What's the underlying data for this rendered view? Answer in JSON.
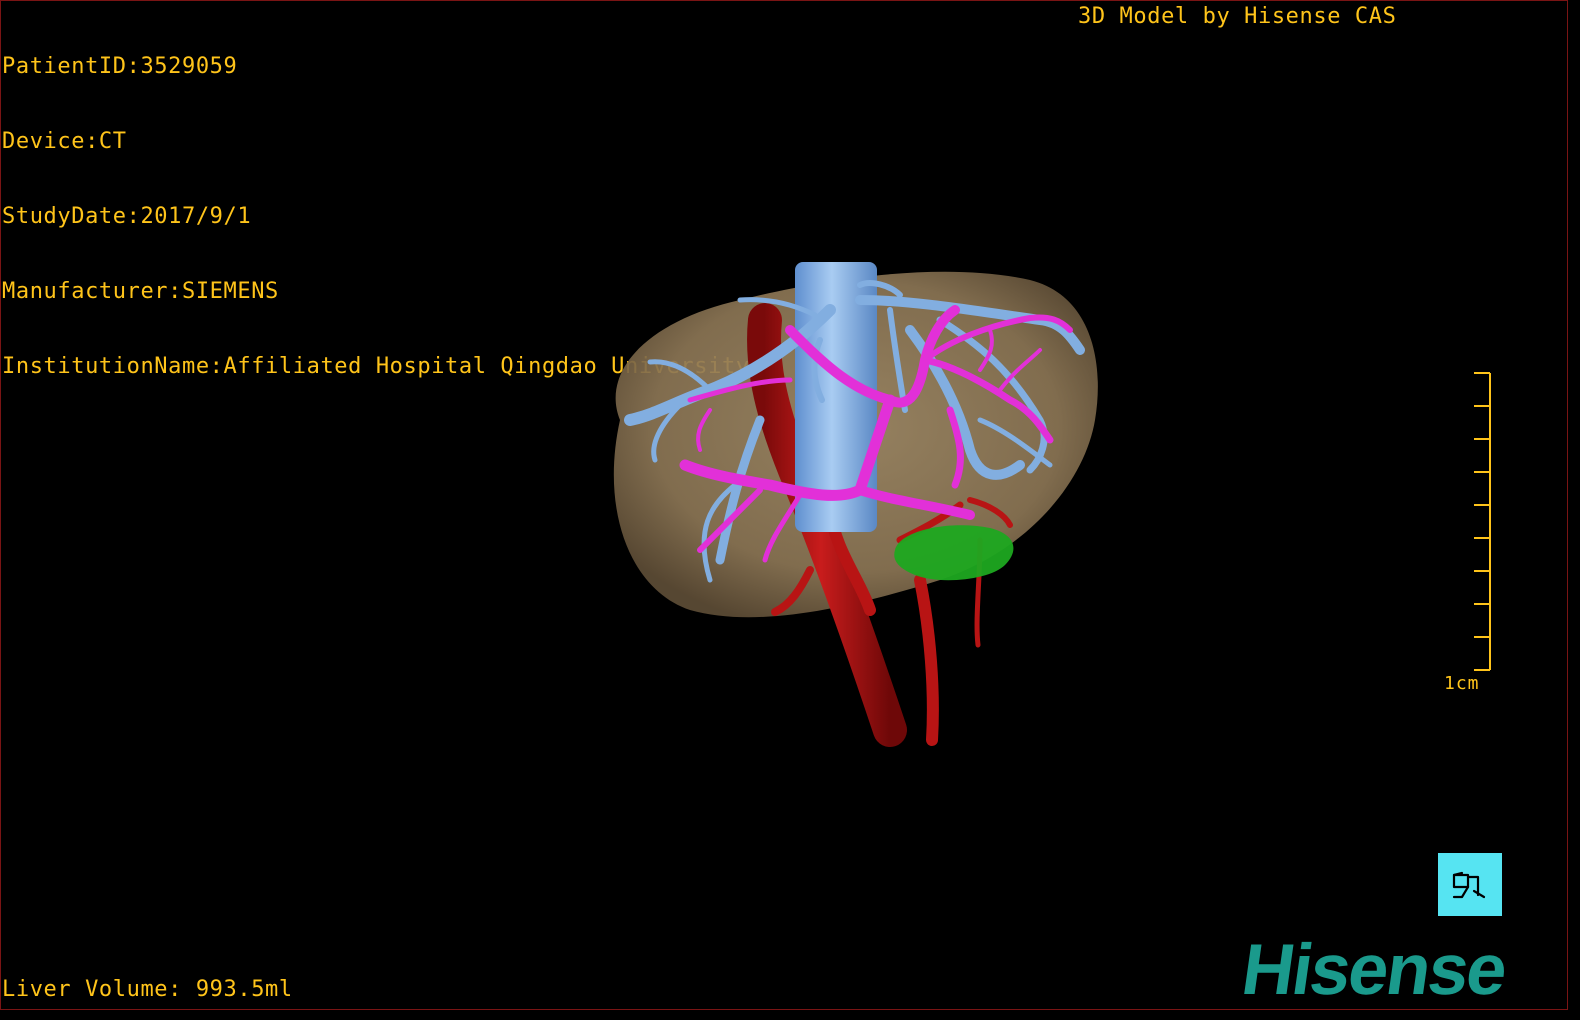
{
  "header": {
    "patient_id_label": "PatientID:3529059",
    "device_label": "Device:CT",
    "study_date_label": "StudyDate:2017/9/1",
    "manufacturer_label": "Manufacturer:SIEMENS",
    "institution_label": "InstitutionName:Affiliated Hospital Qingdao University-C",
    "vendor_title": "3D Model by Hisense CAS"
  },
  "footer": {
    "liver_volume_label": "Liver Volume: 993.5ml"
  },
  "scale": {
    "label": "1cm"
  },
  "logo": {
    "text": "Hisense"
  },
  "icons": {
    "orientation": "body-orientation-icon"
  },
  "colors": {
    "overlay_text": "#ffc41a",
    "liver": "#9c8563",
    "hepatic_vein": "#82aee0",
    "portal_vein": "#e230d8",
    "artery": "#b81414",
    "tumor": "#1ea820",
    "orientation_button": "#56e4f2",
    "logo": "#1a9a8c"
  }
}
